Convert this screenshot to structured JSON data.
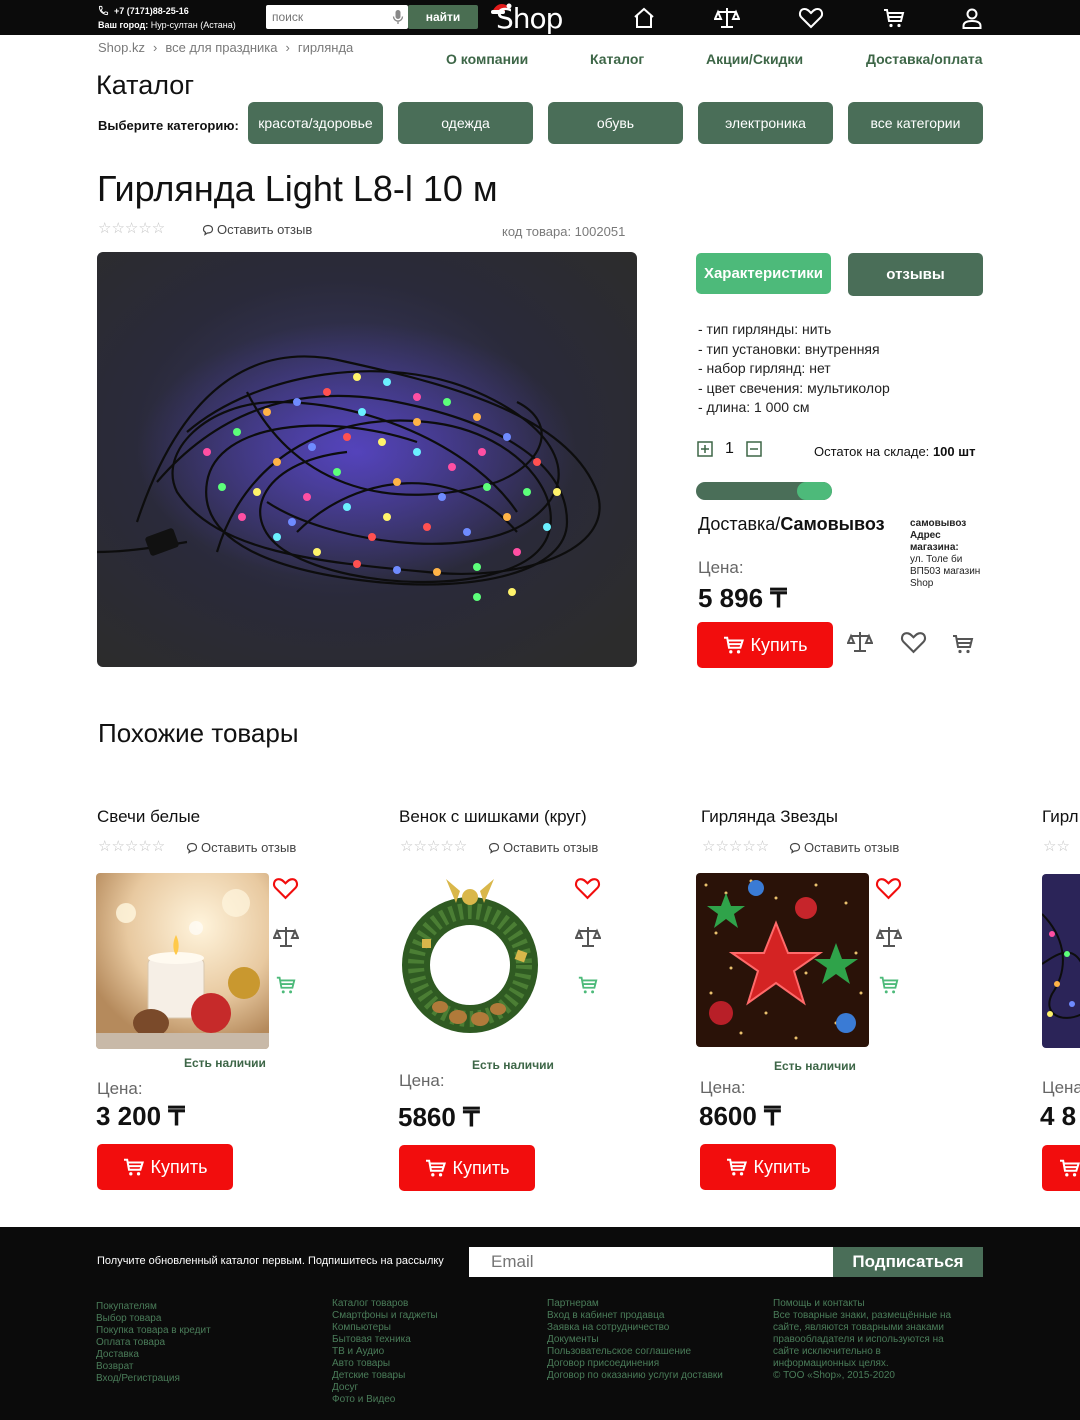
{
  "header": {
    "phone": "+7 (7171)88-25-16",
    "city_label": "Ваш город:",
    "city": "Нур-султан (Астана)",
    "search_placeholder": "поиск",
    "search_button": "найти",
    "logo": "Shop"
  },
  "breadcrumb": [
    "Shop.kz",
    "все для праздника",
    "гирлянда"
  ],
  "nav": [
    "О компании",
    "Каталог",
    "Акции/Скидки",
    "Доставка/оплата"
  ],
  "catalog": {
    "title": "Каталог",
    "choose_label": "Выберите категорию:",
    "categories": [
      "красота/здоровье",
      "одежда",
      "обувь",
      "электроника",
      "все категории"
    ]
  },
  "product": {
    "title": "Гирлянда Light L8-l 10 м",
    "stars": "☆☆☆☆☆",
    "review_link": "Оставить отзыв",
    "sku": "код товара: 1002051",
    "tab_specs": "Характеристики",
    "tab_reviews": "отзывы",
    "specs": [
      "- тип гирлянды: нить",
      "- тип установки: внутренняя",
      "- набор гирлянд: нет",
      "- цвет свечения: мультиколор",
      "- длина: 1 000 см"
    ],
    "quantity": "1",
    "stock_label": "Остаток на складе:",
    "stock_value": "100 шт",
    "delivery_prefix": "Доставка/",
    "delivery_bold": "Самовывоз",
    "pickup_title": "самовывоз",
    "pickup_addr_label": "Адрес магазина:",
    "pickup_addr": "ул. Толе би ВП503 магазин Shop",
    "price_label": "Цена:",
    "price": "5 896 ₸",
    "buy_label": "Купить",
    "delivery_toggle_fraction": 0.26
  },
  "similar": {
    "title": "Похожие товары",
    "items": [
      {
        "title": "Свечи белые",
        "review": "Оставить отзыв",
        "stars": "☆☆☆☆☆",
        "avail": "Есть наличии",
        "price_label": "Цена:",
        "price": "3 200 ₸",
        "buy": "Купить"
      },
      {
        "title": "Венок с шишками (круг)",
        "review": "Оставить отзыв",
        "stars": "☆☆☆☆☆",
        "avail": "Есть наличии",
        "price_label": "Цена:",
        "price": "5860 ₸",
        "buy": "Купить"
      },
      {
        "title": "Гирлянда Звезды",
        "review": "Оставить отзыв",
        "stars": "☆☆☆☆☆",
        "avail": "Есть наличии",
        "price_label": "Цена:",
        "price": "8600 ₸",
        "buy": "Купить"
      },
      {
        "title": "Гирл",
        "stars": "☆☆",
        "price_label": "Цена",
        "price": "4 8"
      }
    ]
  },
  "footer": {
    "subscribe_text": "Получите обновленный каталог первым. Подпишитесь на рассылку",
    "email_placeholder": "Email",
    "subscribe_button": "Подписаться",
    "col1": [
      "Покупателям",
      "Выбор товара",
      "Покупка товара в кредит",
      "Оплата товара",
      "Доставка",
      "Возврат",
      "Вход/Регистрация"
    ],
    "col2": [
      "Каталог товаров",
      "Смартфоны и гаджеты",
      "Компьютеры",
      "Бытовая техника",
      "ТВ и Аудио",
      "Авто товары",
      "Детские товары",
      "Досуг",
      "Фото и Видео"
    ],
    "col3": [
      "Партнерам",
      "Вход в кабинет продавца",
      "Заявка на сотрудничество",
      "Документы",
      "Пользовательское соглашение",
      "Договор присоединения",
      "Договор по оказанию услуги доставки"
    ],
    "col4": [
      "Помощь и контакты",
      "Все товарные знаки, размещённые на",
      "сайте, являются товарными знаками",
      "правообладателя и используются на",
      "сайте исключительно в",
      "информационных целях.",
      "© ТОО «Shop», 2015-2020"
    ]
  },
  "colors": {
    "topbar": "#0b0b0b",
    "accent_dark_green": "#4a6e58",
    "accent_light_green": "#4dba7a",
    "buy_red": "#f20d0d",
    "link_green": "#3d6647"
  }
}
